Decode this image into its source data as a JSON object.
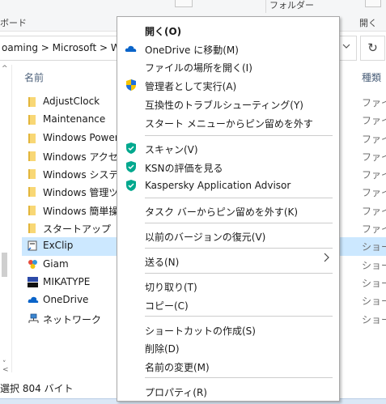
{
  "ribbon": {
    "clipboard_label": "ボード",
    "folder_label": "フォルダー",
    "open_label": "開く"
  },
  "address": {
    "path": "oaming  >  Microsoft  >  W",
    "dropdown_icon": "chevron-down-icon",
    "refresh_icon": "refresh-icon"
  },
  "columns": {
    "name": "名前",
    "type": "種類"
  },
  "files": [
    {
      "name": "AdjustClock",
      "type": "ファイル",
      "icon": "folder-icon"
    },
    {
      "name": "Maintenance",
      "type": "ファイル",
      "icon": "folder-icon"
    },
    {
      "name": "Windows PowerS",
      "type": "ファイル",
      "icon": "folder-icon"
    },
    {
      "name": "Windows アクセサ",
      "type": "ファイル",
      "icon": "folder-icon"
    },
    {
      "name": "Windows システム",
      "type": "ファイル",
      "icon": "folder-icon"
    },
    {
      "name": "Windows 管理ツ",
      "type": "ファイル",
      "icon": "folder-icon"
    },
    {
      "name": "Windows 簡単操",
      "type": "ファイル",
      "icon": "folder-icon"
    },
    {
      "name": "スタートアップ",
      "type": "ファイル",
      "icon": "folder-icon"
    },
    {
      "name": "ExClip",
      "type": "ショート",
      "icon": "exclip-shortcut-icon",
      "selected": true
    },
    {
      "name": "Giam",
      "type": "ショート",
      "icon": "giam-shortcut-icon"
    },
    {
      "name": "MIKATYPE",
      "type": "ショート",
      "icon": "mikatype-shortcut-icon"
    },
    {
      "name": "OneDrive",
      "type": "ショート",
      "icon": "onedrive-shortcut-icon"
    },
    {
      "name": "ネットワーク",
      "type": "ショート",
      "icon": "network-shortcut-icon"
    }
  ],
  "status": {
    "text": "選択  804 バイト"
  },
  "context_menu": {
    "items": [
      {
        "label": "開く(O)",
        "bold": true
      },
      {
        "label": "OneDrive に移動(M)",
        "icon": "onedrive-cloud-icon"
      },
      {
        "label": "ファイルの場所を開く(I)"
      },
      {
        "label": "管理者として実行(A)",
        "icon": "uac-shield-icon"
      },
      {
        "label": "互換性のトラブルシューティング(Y)"
      },
      {
        "label": "スタート メニューからピン留めを外す"
      },
      {
        "label": "スキャン(V)",
        "icon": "kaspersky-shield-icon"
      },
      {
        "label": "KSNの評価を見る",
        "icon": "kaspersky-shield-icon"
      },
      {
        "label": "Kaspersky Application Advisor",
        "icon": "kaspersky-shield-icon"
      },
      {
        "label": "タスク バーからピン留めを外す(K)"
      },
      {
        "label": "以前のバージョンの復元(V)"
      },
      {
        "label": "送る(N)",
        "submenu": true
      },
      {
        "label": "切り取り(T)"
      },
      {
        "label": "コピー(C)"
      },
      {
        "label": "ショートカットの作成(S)"
      },
      {
        "label": "削除(D)"
      },
      {
        "label": "名前の変更(M)"
      },
      {
        "label": "プロパティ(R)"
      }
    ]
  },
  "colors": {
    "selection": "#cce8ff",
    "kaspersky_green": "#00a88e",
    "onedrive_blue": "#0a64c9",
    "folder_yellow": "#f8d775"
  }
}
